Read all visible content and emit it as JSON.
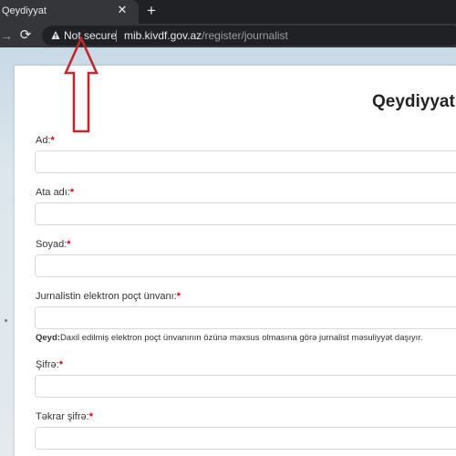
{
  "browser": {
    "tab_title": "Qeydiyyat",
    "tab_close": "✕",
    "new_tab": "+",
    "forward_icon": "→",
    "reload_icon": "⟳",
    "security_label": "Not secure",
    "url_host": "mib.kivdf.gov.az",
    "url_path": "/register/journalist"
  },
  "form": {
    "title": "Qeydiyyat",
    "required_mark": "*",
    "fields": [
      {
        "label": "Ad:",
        "value": ""
      },
      {
        "label": "Ata adı:",
        "value": ""
      },
      {
        "label": "Soyad:",
        "value": ""
      },
      {
        "label": "Jurnalistin elektron poçt ünvanı:",
        "value": ""
      },
      {
        "label": "Şifrə:",
        "value": ""
      },
      {
        "label": "Təkrar şifrə:",
        "value": ""
      }
    ],
    "note_label": "Qeyd:",
    "note_text": "Daxil edilmiş elektron poçt ünvanının özünə məxsus olmasına görə jurnalist məsuliyyət daşıyır."
  },
  "annotation": {
    "arrow_color": "#c0282d",
    "arrow_icon": "up-arrow-outline"
  }
}
